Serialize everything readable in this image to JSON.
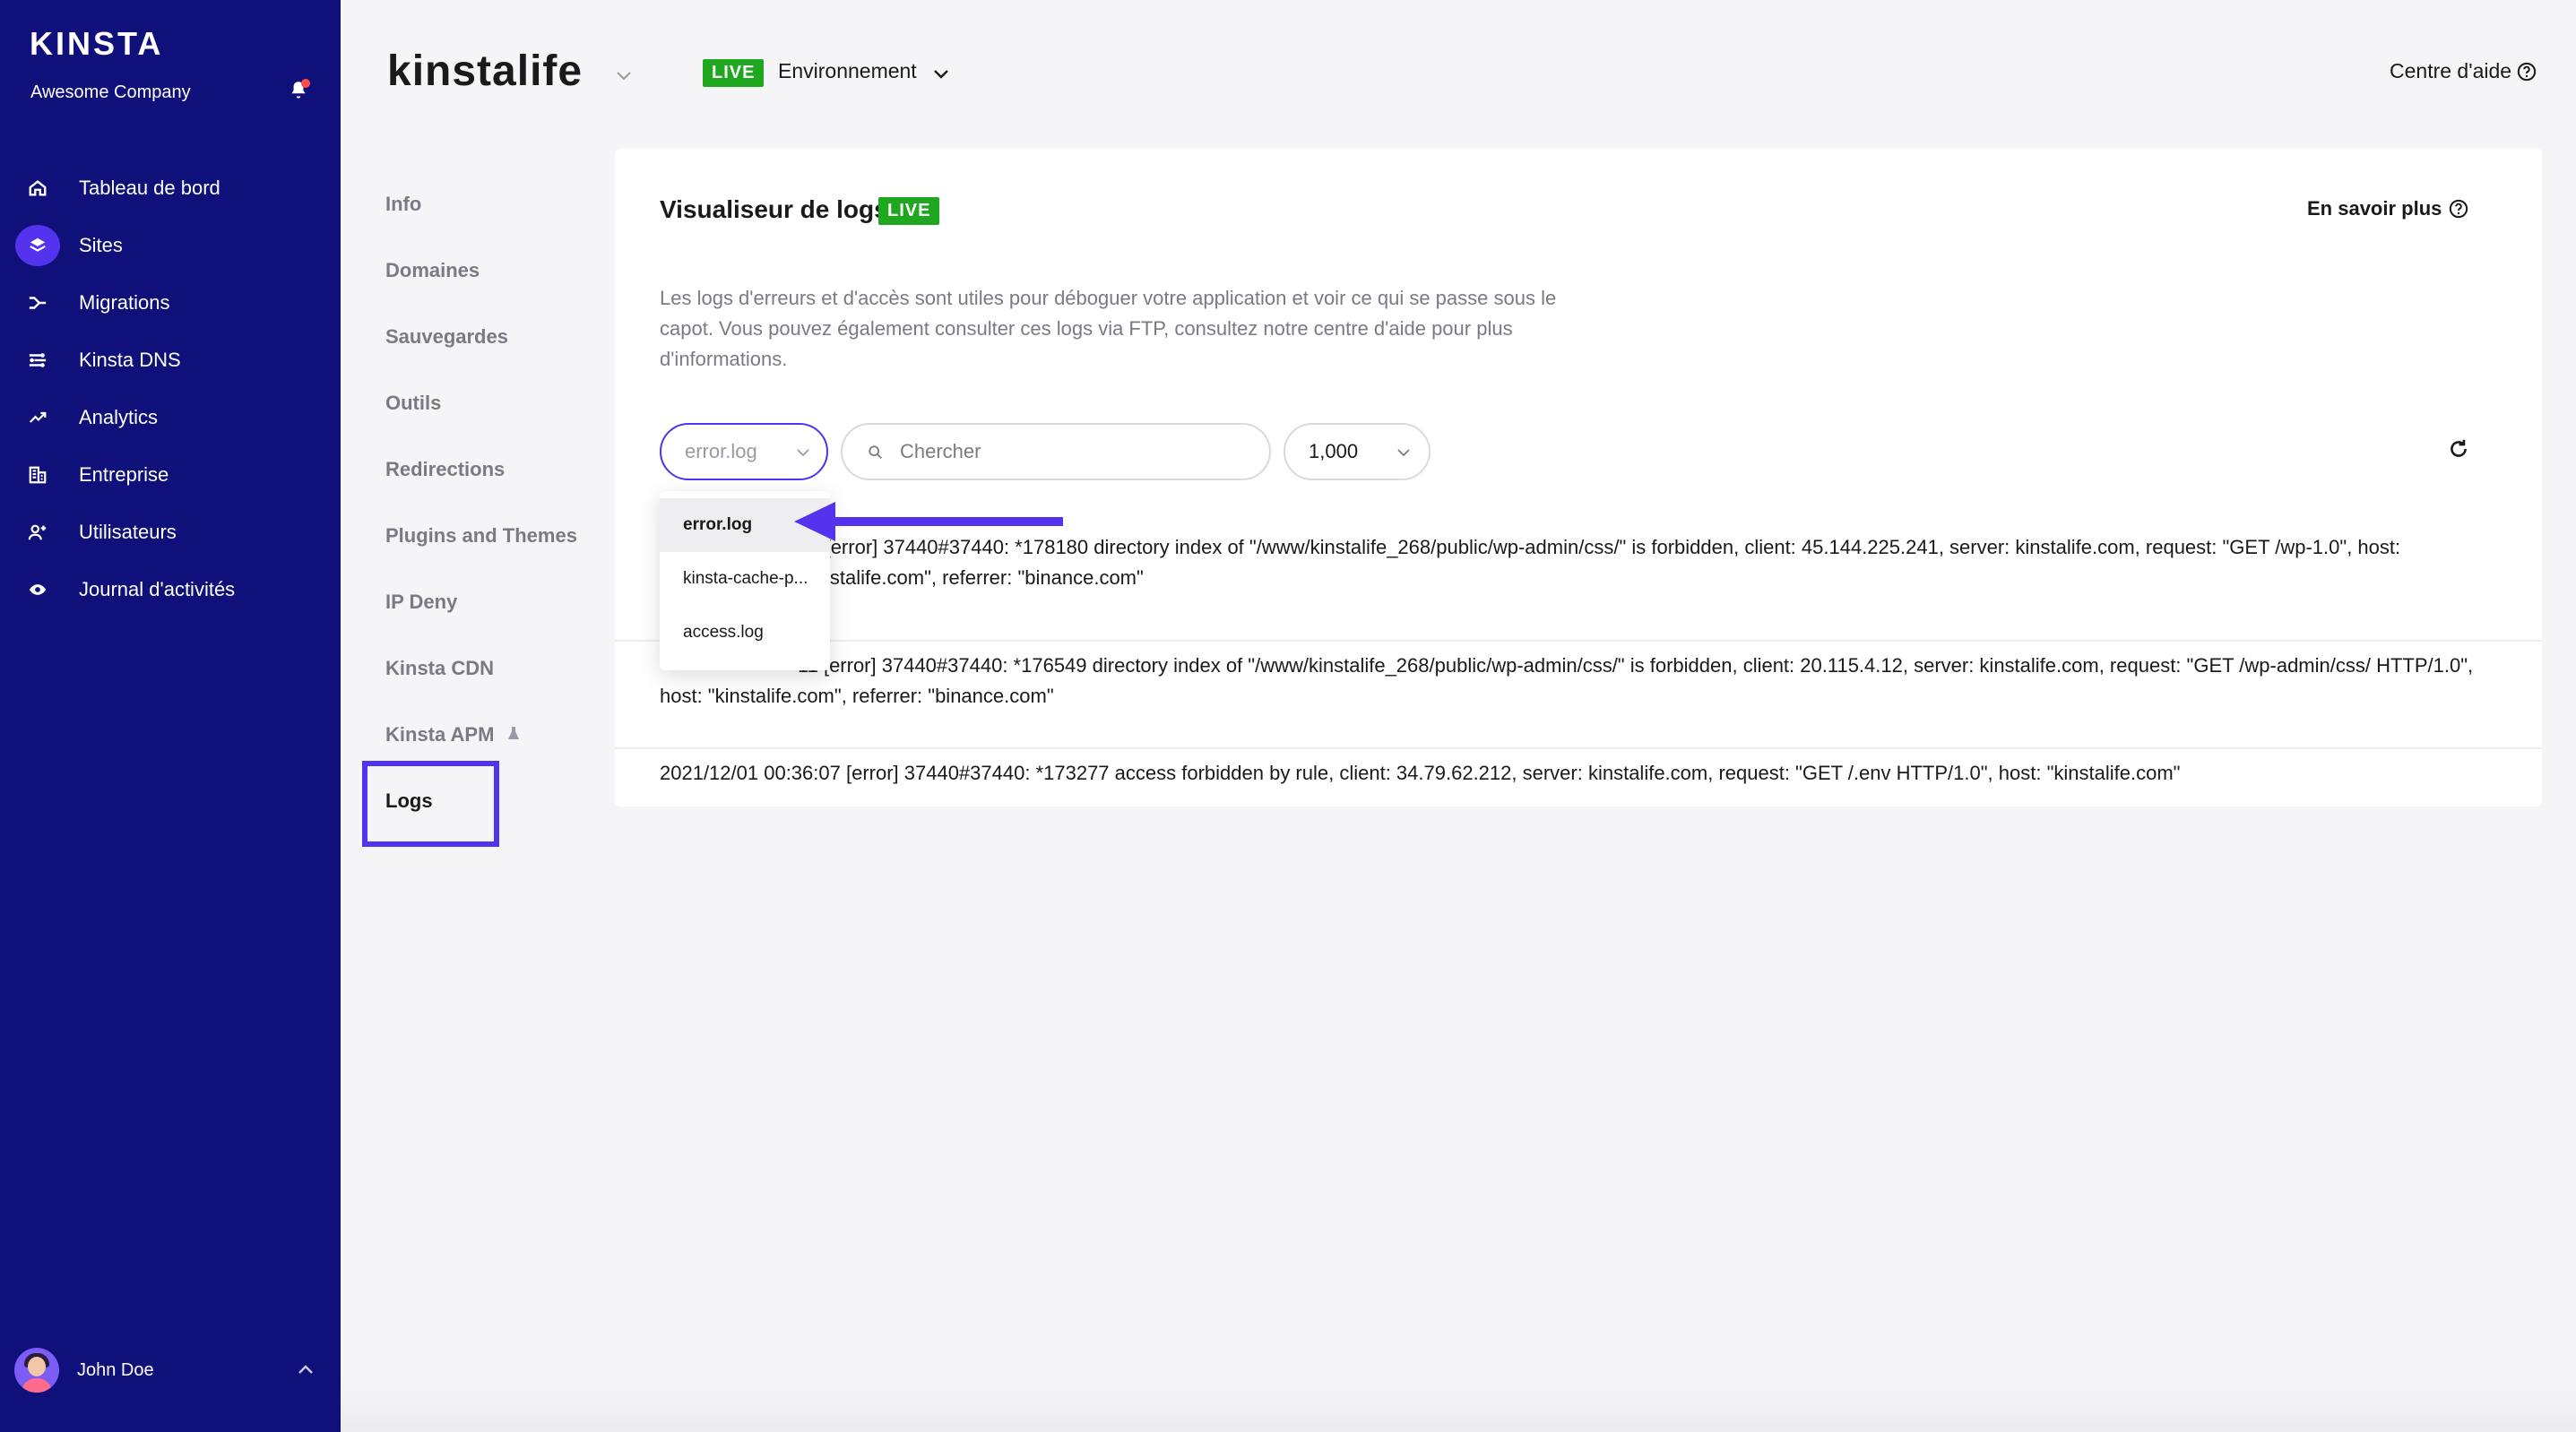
{
  "sidebar": {
    "brand": "KINSTA",
    "company": "Awesome Company",
    "items": [
      {
        "label": "Tableau de bord",
        "icon": "home-icon"
      },
      {
        "label": "Sites",
        "icon": "layers-icon"
      },
      {
        "label": "Migrations",
        "icon": "migrations-icon"
      },
      {
        "label": "Kinsta DNS",
        "icon": "dns-icon"
      },
      {
        "label": "Analytics",
        "icon": "analytics-icon"
      },
      {
        "label": "Entreprise",
        "icon": "company-icon"
      },
      {
        "label": "Utilisateurs",
        "icon": "add-user-icon"
      },
      {
        "label": "Journal d'activités",
        "icon": "eye-icon"
      }
    ],
    "user": "John Doe"
  },
  "header": {
    "site_title": "kinstalife",
    "env_badge": "LIVE",
    "env_label": "Environnement",
    "help": "Centre d'aide"
  },
  "subnav": {
    "items": [
      "Info",
      "Domaines",
      "Sauvegardes",
      "Outils",
      "Redirections",
      "Plugins and Themes",
      "IP Deny",
      "Kinsta CDN",
      "Kinsta APM",
      "Logs"
    ]
  },
  "card": {
    "title": "Visualiseur de logs",
    "badge": "LIVE",
    "learn_more": "En savoir plus",
    "description": "Les logs d'erreurs et d'accès sont utiles pour déboguer votre application et voir ce qui se passe sous le capot. Vous pouvez également consulter ces logs via FTP, consultez notre centre d'aide pour plus d'informations.",
    "file_select": "error.log",
    "search_placeholder": "Chercher",
    "count": "1,000",
    "logs": [
      "35 [error] 37440#37440: *178180 directory index of \"/www/kinstalife_268/public/wp-admin/css/\" is forbidden, client: 45.144.225.241, server: kinstalife.com, request: \"GET /wp-1.0\", host: \"kinstalife.com\", referrer: \"binance.com\"",
      "11 [error] 37440#37440: *176549 directory index of \"/www/kinstalife_268/public/wp-admin/css/\" is forbidden, client: 20.115.4.12, server: kinstalife.com, request: \"GET /wp-admin/css/ HTTP/1.0\", host: \"kinstalife.com\", referrer: \"binance.com\"",
      "2021/12/01 00:36:07 [error] 37440#37440: *173277 access forbidden by rule, client: 34.79.62.212, server: kinstalife.com, request: \"GET /.env HTTP/1.0\", host: \"kinstalife.com\""
    ]
  },
  "dropdown": {
    "options": [
      "error.log",
      "kinsta-cache-p...",
      "access.log"
    ]
  },
  "colors": {
    "sidebar_bg": "#10107a",
    "accent": "#5333ed",
    "live_green": "#1fa81f"
  }
}
